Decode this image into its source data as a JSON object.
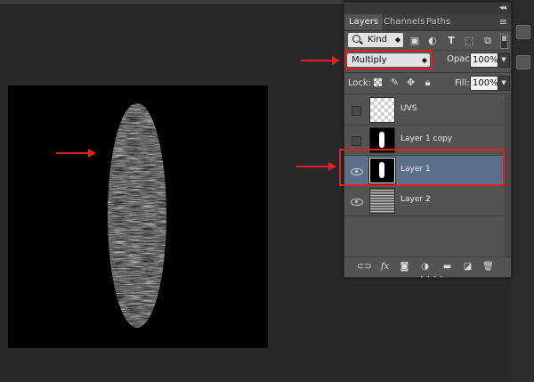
{
  "panel": {
    "collapse_icon": "double-chevron-icon",
    "tabs": [
      {
        "label": "Layers",
        "active": true
      },
      {
        "label": "Channels",
        "active": false
      },
      {
        "label": "Paths",
        "active": false
      }
    ],
    "menu_icon": "panel-menu-icon"
  },
  "filter": {
    "kind_label": "Kind",
    "icons": [
      "pixel-layer-filter-icon",
      "adjustment-layer-filter-icon",
      "type-layer-filter-icon",
      "shape-layer-filter-icon",
      "smart-object-filter-icon"
    ]
  },
  "blend": {
    "mode": "Multiply",
    "opacity_label": "Opacity:",
    "opacity_value": "100%",
    "fill_label": "Fill:",
    "fill_value": "100%"
  },
  "lock": {
    "label": "Lock:",
    "icons": [
      "lock-transparent-pixels-icon",
      "lock-image-pixels-icon",
      "lock-position-icon",
      "lock-all-icon"
    ]
  },
  "layers": [
    {
      "name": "UVS",
      "visible": false,
      "thumb": "transparent"
    },
    {
      "name": "Layer 1 copy",
      "visible": false,
      "thumb": "mask"
    },
    {
      "name": "Layer 1",
      "visible": true,
      "thumb": "mask",
      "selected": true
    },
    {
      "name": "Layer 2",
      "visible": true,
      "thumb": "noise"
    }
  ],
  "bottom_bar": {
    "fx_label": "fx",
    "icons": [
      "link-layers-icon",
      "layer-style-icon",
      "add-mask-icon",
      "adjustment-layer-icon",
      "new-group-icon",
      "new-layer-icon",
      "delete-layer-icon"
    ]
  },
  "colors": {
    "annotation_red": "#e51f1f",
    "selected_row": "#5b6e8a",
    "panel_bg": "#535353",
    "app_bg": "#282828"
  }
}
